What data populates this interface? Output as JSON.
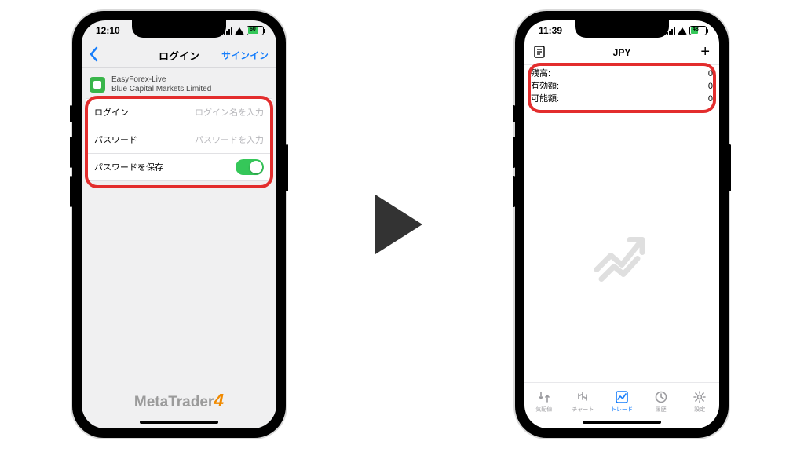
{
  "left": {
    "status": {
      "time": "12:10",
      "battery_pct": "60"
    },
    "nav": {
      "title": "ログイン",
      "action": "サインイン"
    },
    "server": {
      "name": "EasyForex-Live",
      "company": "Blue Capital Markets Limited"
    },
    "rows": {
      "login_label": "ログイン",
      "login_placeholder": "ログイン名を入力",
      "password_label": "パスワード",
      "password_placeholder": "パスワードを入力",
      "save_label": "パスワードを保存"
    },
    "brand": {
      "text": "MetaTrader",
      "four": "4"
    }
  },
  "right": {
    "status": {
      "time": "11:39",
      "battery_pct": "48"
    },
    "nav": {
      "title": "JPY",
      "plus": "+"
    },
    "balances": [
      {
        "label": "残高:",
        "value": "0"
      },
      {
        "label": "有効額:",
        "value": "0"
      },
      {
        "label": "可能額:",
        "value": "0"
      }
    ],
    "tabs": [
      {
        "label": "気配値"
      },
      {
        "label": "チャート"
      },
      {
        "label": "トレード"
      },
      {
        "label": "履歴"
      },
      {
        "label": "設定"
      }
    ]
  }
}
